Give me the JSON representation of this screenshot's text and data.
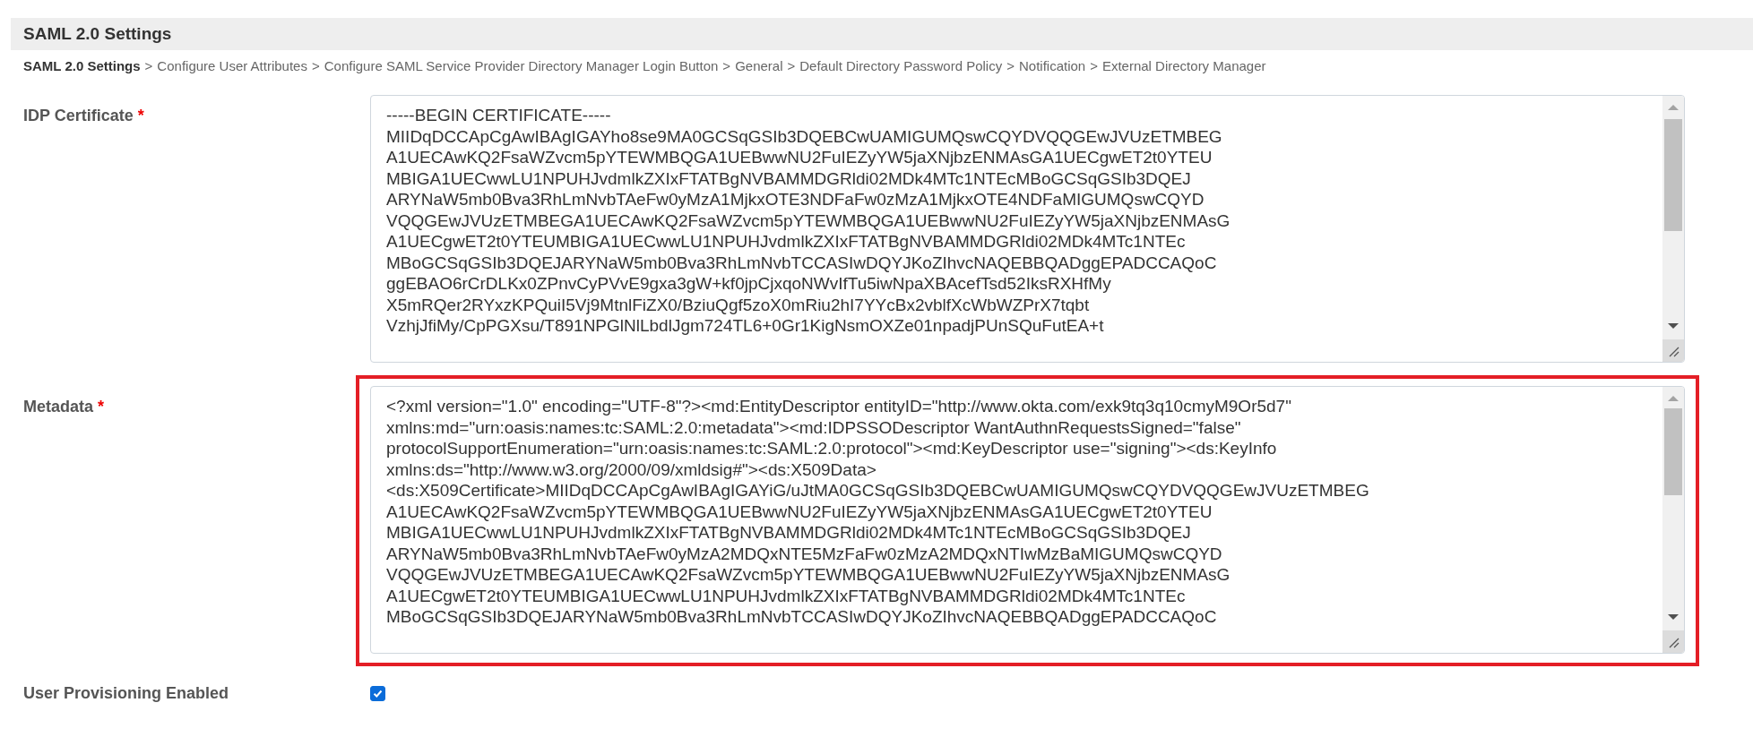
{
  "header": {
    "title": "SAML 2.0 Settings"
  },
  "breadcrumb": [
    {
      "label": "SAML 2.0 Settings",
      "selected": true
    },
    {
      "separator": ">",
      "label": "Configure User Attributes",
      "selected": false
    },
    {
      "separator": ">",
      "label": "Configure SAML Service Provider Directory Manager Login Button",
      "selected": false
    },
    {
      "separator": ">",
      "label": "General",
      "selected": false
    },
    {
      "separator": ">",
      "label": "Default Directory Password Policy",
      "selected": false
    },
    {
      "separator": ">",
      "label": "Notification",
      "selected": false
    },
    {
      "separator": ">",
      "label": "External Directory Manager",
      "selected": false
    }
  ],
  "fields": [
    {
      "label": "IDP Certificate",
      "required_mark": "*",
      "highlighted": false,
      "lines": [
        "-----BEGIN CERTIFICATE-----",
        "MIIDqDCCApCgAwIBAgIGAYho8se9MA0GCSqGSIb3DQEBCwUAMIGUMQswCQYDVQQGEwJVUzETMBEG",
        "A1UECAwKQ2FsaWZvcm5pYTEWMBQGA1UEBwwNU2FuIEZyYW5jaXNjbzENMAsGA1UECgwET2t0YTEU",
        "MBIGA1UECwwLU1NPUHJvdmlkZXIxFTATBgNVBAMMDGRldi02MDk4MTc1NTEcMBoGCSqGSIb3DQEJ",
        "ARYNaW5mb0Bva3RhLmNvbTAeFw0yMzA1MjkxOTE3NDFaFw0zMzA1MjkxOTE4NDFaMIGUMQswCQYD",
        "VQQGEwJVUzETMBEGA1UECAwKQ2FsaWZvcm5pYTEWMBQGA1UEBwwNU2FuIEZyYW5jaXNjbzENMAsG",
        "A1UECgwET2t0YTEUMBIGA1UECwwLU1NPUHJvdmlkZXIxFTATBgNVBAMMDGRldi02MDk4MTc1NTEc",
        "MBoGCSqGSIb3DQEJARYNaW5mb0Bva3RhLmNvbTCCASIwDQYJKoZIhvcNAQEBBQADggEPADCCAQoC",
        "ggEBAO6rCrDLKx0ZPnvCyPVvE9gxa3gW+kf0jpCjxqoNWvIfTu5iwNpaXBAcefTsd52IksRXHfMy",
        "X5mRQer2RYxzKPQuiI5Vj9MtnlFiZX0/BziuQgf5zoX0mRiu2hI7YYcBx2vblfXcWbWZPrX7tqbt",
        "VzhjJfiMy/CpPGXsu/T891NPGlNlLbdlJgm724TL6+0Gr1KigNsmOXZe01npadjPUnSQuFutEA+t"
      ]
    },
    {
      "label": "Metadata",
      "required_mark": "*",
      "highlighted": true,
      "lines": [
        "<?xml version=\"1.0\" encoding=\"UTF-8\"?><md:EntityDescriptor entityID=\"http://www.okta.com/exk9tq3q10cmyM9Or5d7\"",
        "xmlns:md=\"urn:oasis:names:tc:SAML:2.0:metadata\"><md:IDPSSODescriptor WantAuthnRequestsSigned=\"false\"",
        "protocolSupportEnumeration=\"urn:oasis:names:tc:SAML:2.0:protocol\"><md:KeyDescriptor use=\"signing\"><ds:KeyInfo",
        "xmlns:ds=\"http://www.w3.org/2000/09/xmldsig#\"><ds:X509Data>",
        "<ds:X509Certificate>MIIDqDCCApCgAwIBAgIGAYiG/uJtMA0GCSqGSIb3DQEBCwUAMIGUMQswCQYDVQQGEwJVUzETMBEG",
        "A1UECAwKQ2FsaWZvcm5pYTEWMBQGA1UEBwwNU2FuIEZyYW5jaXNjbzENMAsGA1UECgwET2t0YTEU",
        "MBIGA1UECwwLU1NPUHJvdmlkZXIxFTATBgNVBAMMDGRldi02MDk4MTc1NTEcMBoGCSqGSIb3DQEJ",
        "ARYNaW5mb0Bva3RhLmNvbTAeFw0yMzA2MDQxNTE5MzFaFw0zMzA2MDQxNTIwMzBaMIGUMQswCQYD",
        "VQQGEwJVUzETMBEGA1UECAwKQ2FsaWZvcm5pYTEWMBQGA1UEBwwNU2FuIEZyYW5jaXNjbzENMAsG",
        "A1UECgwET2t0YTEUMBIGA1UECwwLU1NPUHJvdmlkZXIxFTATBgNVBAMMDGRldi02MDk4MTc1NTEc",
        "MBoGCSqGSIb3DQEJARYNaW5mb0Bva3RhLmNvbTCCASIwDQYJKoZIhvcNAQEBBQADggEPADCCAQoC"
      ]
    }
  ],
  "checkbox": {
    "label": "User Provisioning Enabled",
    "checked": true
  }
}
